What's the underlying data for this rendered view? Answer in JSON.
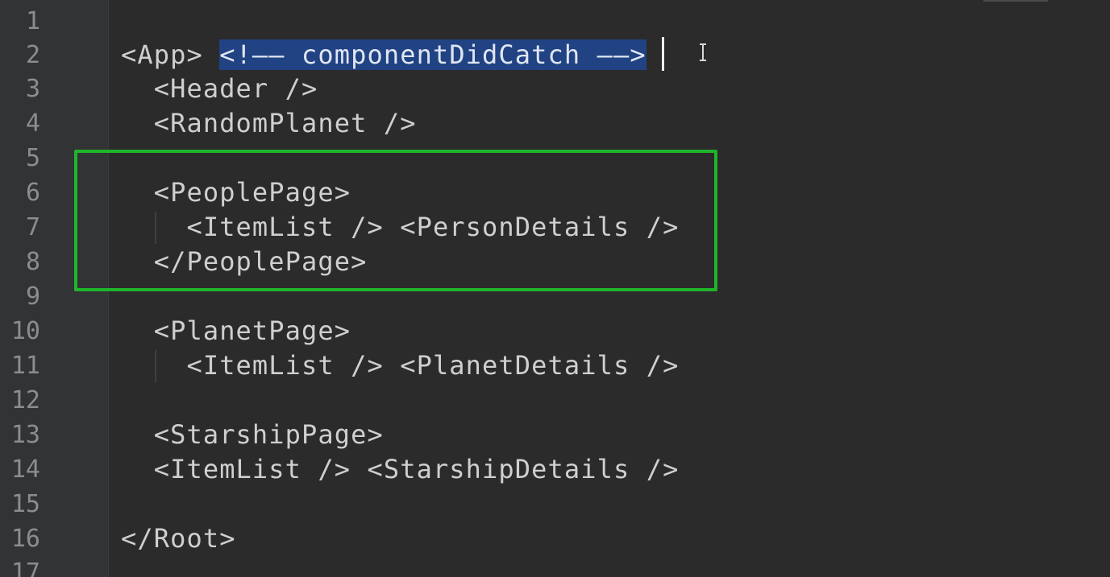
{
  "editor": {
    "line_numbers": [
      "1",
      "2",
      "3",
      "4",
      "5",
      "6",
      "7",
      "8",
      "9",
      "10",
      "11",
      "12",
      "13",
      "14",
      "15",
      "16",
      "17"
    ],
    "lines": [
      "",
      "<App>",
      "  <Header />",
      "  <RandomPlanet />",
      "",
      "  <PeoplePage>",
      "    <ItemList /> <PersonDetails />",
      "  </PeoplePage>",
      "",
      "  <PlanetPage>",
      "    <ItemList /> <PlanetDetails />",
      "",
      "  <StarshipPage>",
      "  <ItemList /> <StarshipDetails />",
      "",
      "</Root>",
      ""
    ],
    "selected_comment": "<!—— componentDidCatch ——>",
    "colors": {
      "background": "#2b2b2b",
      "gutter": "#313335",
      "selection": "#214283",
      "highlight_box": "#1fb52b"
    }
  }
}
